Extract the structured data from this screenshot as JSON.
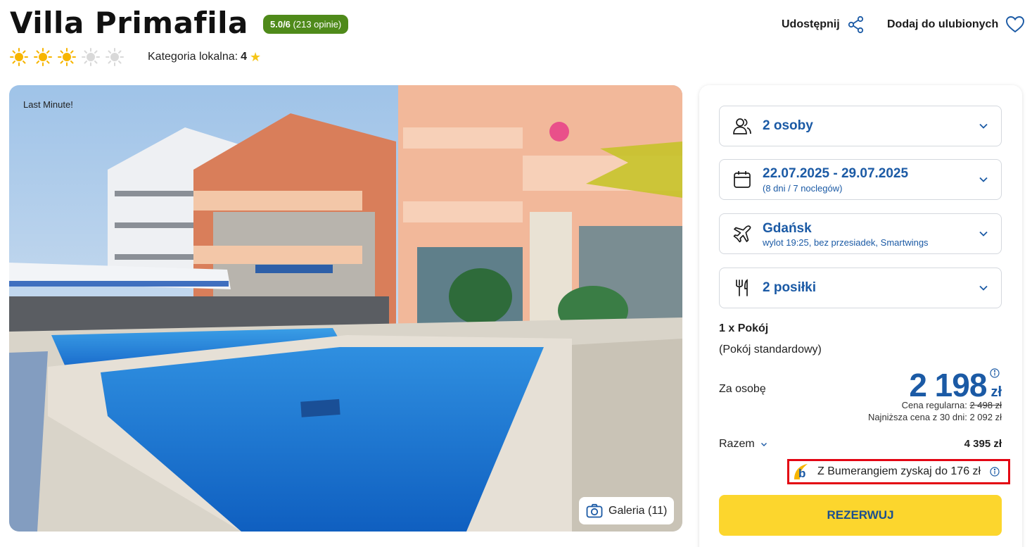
{
  "hotel": {
    "name": "Villa Primafila",
    "rating_score": "5.0/6",
    "rating_count": "(213 opinie)",
    "sun_rating": 3,
    "sun_max": 5,
    "category_label": "Kategoria lokalna:",
    "category_value": "4"
  },
  "actions": {
    "share_label": "Udostępnij",
    "favorite_label": "Dodaj do ulubionych"
  },
  "photo": {
    "tag": "Last Minute!",
    "gallery_label": "Galeria (11)"
  },
  "booking": {
    "guests": "2 osoby",
    "dates": "22.07.2025 - 29.07.2025",
    "dates_sub": "(8 dni / 7 noclegów)",
    "departure_city": "Gdańsk",
    "departure_sub": "wylot 19:25, bez przesiadek, Smartwings",
    "meals": "2 posiłki",
    "room_count": "1 x Pokój",
    "room_type": "(Pokój standardowy)",
    "per_person_label": "Za osobę",
    "price": "2 198",
    "currency": "zł",
    "regular_label": "Cena regularna:",
    "regular_price": "2 498 zł",
    "lowest_price_text": "Najniższa cena z 30 dni: 2 092 zł",
    "total_label": "Razem",
    "total_value": "4 395 zł",
    "bumerang_text": "Z Bumerangiem zyskaj do 176 zł",
    "reserve_label": "REZERWUJ"
  },
  "colors": {
    "brand_blue": "#1b5aa5",
    "rating_green": "#4f8a1a",
    "cta_yellow": "#fcd62d",
    "highlight_red": "#e30613",
    "sun_active": "#f7b500",
    "sun_inactive": "#d9d9d9"
  },
  "icons": {
    "share": "share-icon",
    "favorite": "heart-icon",
    "guests": "people-icon",
    "dates": "calendar-icon",
    "flight": "plane-icon",
    "meals": "fork-knife-icon",
    "gallery": "camera-icon",
    "info": "info-icon",
    "dropdown": "chevron-down-icon"
  }
}
